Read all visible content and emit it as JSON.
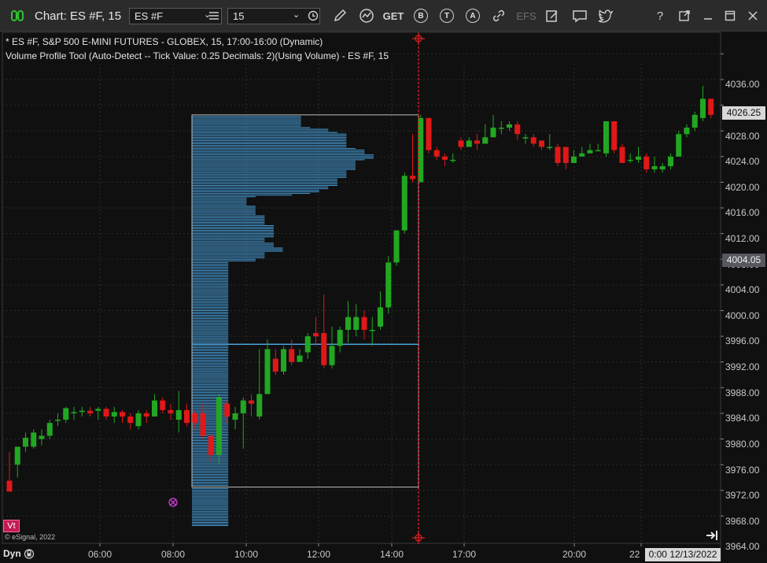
{
  "toolbar": {
    "title": "Chart: ES #F, 15",
    "symbol_value": "ES #F",
    "interval_value": "15",
    "get_label": "GET",
    "b_label": "B",
    "t_label": "T",
    "a_label": "A",
    "efs_label": "EFS",
    "help_label": "?"
  },
  "info": {
    "line1": "* ES #F, S&P 500 E-MINI FUTURES - GLOBEX, 15, 17:00-16:00 (Dynamic)",
    "line2": "Volume Profile Tool (Auto-Detect -- Tick Value: 0.25 Decimals: 2)(Using Volume) - ES #F, 15"
  },
  "footer": {
    "copyright": "© eSignal, 2022",
    "dyn_label": "Dyn",
    "vt_label": "Vt",
    "cursor_time": "0:00 12/13/2022"
  },
  "colors": {
    "up": "#22a722",
    "down": "#e01818",
    "profile": "#4aa3e0",
    "crosshair": "#e02020"
  },
  "price_tags": {
    "last": "4026.25",
    "cursor": "4004.05"
  },
  "chart_data": {
    "type": "candlestick",
    "symbol": "ES #F",
    "interval": "15",
    "y_ticks": [
      "4036.00",
      "4032.00",
      "4028.00",
      "4024.00",
      "4020.00",
      "4016.00",
      "4012.00",
      "4008.00",
      "4004.00",
      "4000.00",
      "3996.00",
      "3992.00",
      "3988.00",
      "3984.00",
      "3980.00",
      "3976.00",
      "3972.00",
      "3968.00",
      "3964.00"
    ],
    "x_ticks": [
      "06:00",
      "08:00",
      "10:00",
      "12:00",
      "14:00",
      "17:00",
      "20:00",
      "22"
    ],
    "ylim": [
      3962.2,
      4038.5
    ],
    "candles": [
      [
        3969.5,
        3967.8,
        3974.0,
        3969.5
      ],
      [
        3972.0,
        3974.8,
        3974.5,
        3970.0
      ],
      [
        3974.8,
        3976.2,
        3977.0,
        3974.0
      ],
      [
        3974.8,
        3977.0,
        3977.5,
        3974.5
      ],
      [
        3976.0,
        3976.5,
        3977.5,
        3975.0
      ],
      [
        3976.5,
        3978.5,
        3979.0,
        3976.0
      ],
      [
        3979.0,
        3979.0,
        3980.0,
        3978.0
      ],
      [
        3979.0,
        3980.8,
        3981.0,
        3978.5
      ],
      [
        3980.0,
        3980.2,
        3981.0,
        3979.0
      ],
      [
        3980.2,
        3980.4,
        3981.0,
        3979.5
      ],
      [
        3980.4,
        3980.0,
        3981.0,
        3979.5
      ],
      [
        3980.4,
        3980.7,
        3981.0,
        3979.0
      ],
      [
        3980.7,
        3979.5,
        3981.0,
        3979.0
      ],
      [
        3979.5,
        3980.2,
        3981.0,
        3978.5
      ],
      [
        3980.2,
        3979.5,
        3980.5,
        3978.5
      ],
      [
        3979.5,
        3978.5,
        3980.0,
        3977.5
      ],
      [
        3978.0,
        3980.0,
        3980.5,
        3977.5
      ],
      [
        3980.0,
        3979.5,
        3980.5,
        3978.5
      ],
      [
        3979.5,
        3982.0,
        3983.0,
        3979.5
      ],
      [
        3982.0,
        3980.5,
        3982.5,
        3980.0
      ],
      [
        3980.5,
        3980.0,
        3981.5,
        3979.0
      ],
      [
        3979.0,
        3980.5,
        3983.5,
        3977.0
      ],
      [
        3980.5,
        3978.5,
        3981.5,
        3978.0
      ],
      [
        3980.0,
        3978.5,
        3980.5,
        3977.5
      ],
      [
        3980.0,
        3976.5,
        3981.5,
        3976.0
      ],
      [
        3976.5,
        3973.5,
        3976.5,
        3972.5
      ],
      [
        3973.5,
        3982.5,
        3983.0,
        3972.0
      ],
      [
        3981.5,
        3979.5,
        3982.0,
        3978.5
      ],
      [
        3979.0,
        3980.0,
        3981.0,
        3977.5
      ],
      [
        3980.0,
        3982.0,
        3982.5,
        3974.5
      ],
      [
        3982.0,
        3981.5,
        3983.0,
        3979.5
      ],
      [
        3979.5,
        3983.0,
        3990.0,
        3979.0
      ],
      [
        3983.0,
        3990.0,
        3991.5,
        3983.0
      ],
      [
        3988.5,
        3986.5,
        3990.0,
        3986.0
      ],
      [
        3986.5,
        3990.0,
        3990.5,
        3986.0
      ],
      [
        3990.0,
        3988.0,
        3991.5,
        3987.5
      ],
      [
        3988.0,
        3989.0,
        3990.0,
        3988.0
      ],
      [
        3989.5,
        3992.0,
        3992.5,
        3988.5
      ],
      [
        3992.5,
        3992.0,
        3995.0,
        3990.5
      ],
      [
        3992.5,
        3987.5,
        3998.5,
        3987.0
      ],
      [
        3987.5,
        3990.5,
        3993.5,
        3987.0
      ],
      [
        3990.5,
        3993.0,
        3993.5,
        3989.5
      ],
      [
        3993.0,
        3995.0,
        3997.5,
        3991.0
      ],
      [
        3993.0,
        3995.0,
        3997.0,
        3992.0
      ],
      [
        3995.0,
        3993.0,
        3996.0,
        3991.5
      ],
      [
        3993.0,
        3993.0,
        3995.0,
        3990.5
      ],
      [
        3993.5,
        3996.5,
        3999.0,
        3993.0
      ],
      [
        3996.5,
        4003.5,
        4004.5,
        3995.5
      ],
      [
        4003.5,
        4008.5,
        4008.5,
        4003.0
      ],
      [
        4008.5,
        4017.0,
        4017.5,
        4008.0
      ],
      [
        4017.0,
        4016.5,
        4023.5,
        4016.0
      ],
      [
        4016.0,
        4026.0,
        4026.5,
        4016.0
      ],
      [
        4026.0,
        4021.0,
        4026.0,
        4020.5
      ],
      [
        4021.0,
        4020.0,
        4021.5,
        4019.5
      ],
      [
        4020.0,
        4019.5,
        4020.5,
        4018.5
      ],
      [
        4019.5,
        4019.5,
        4020.5,
        4019.0
      ],
      [
        4022.5,
        4021.5,
        4023.0,
        4021.0
      ],
      [
        4021.5,
        4022.5,
        4023.0,
        4021.5
      ],
      [
        4022.5,
        4022.0,
        4023.5,
        4021.0
      ],
      [
        4022.0,
        4023.0,
        4025.0,
        4022.5
      ],
      [
        4023.0,
        4024.5,
        4026.5,
        4023.0
      ],
      [
        4024.5,
        4024.5,
        4025.5,
        4023.5
      ],
      [
        4024.5,
        4025.0,
        4025.5,
        4024.0
      ],
      [
        4025.0,
        4023.5,
        4025.5,
        4022.5
      ],
      [
        4023.0,
        4023.0,
        4023.5,
        4022.0
      ],
      [
        4023.0,
        4022.0,
        4023.5,
        4021.5
      ],
      [
        4022.5,
        4021.5,
        4022.5,
        4021.0
      ],
      [
        4021.5,
        4021.5,
        4023.5,
        4021.0
      ],
      [
        4021.5,
        4019.0,
        4022.0,
        4018.5
      ],
      [
        4021.5,
        4019.0,
        4021.5,
        4018.0
      ],
      [
        4019.0,
        4020.0,
        4021.0,
        4019.0
      ],
      [
        4020.0,
        4020.5,
        4021.5,
        4020.0
      ],
      [
        4020.5,
        4021.0,
        4022.0,
        4020.5
      ],
      [
        4021.0,
        4021.0,
        4022.0,
        4021.0
      ],
      [
        4020.5,
        4025.5,
        4025.5,
        4020.0
      ],
      [
        4025.5,
        4021.0,
        4025.5,
        4020.5
      ],
      [
        4021.5,
        4019.0,
        4022.0,
        4019.0
      ],
      [
        4019.5,
        4019.5,
        4020.5,
        4019.0
      ],
      [
        4019.5,
        4020.0,
        4021.5,
        4019.0
      ],
      [
        4020.0,
        4018.0,
        4020.5,
        4017.5
      ],
      [
        4018.0,
        4018.5,
        4020.0,
        4017.5
      ],
      [
        4018.0,
        4018.5,
        4019.0,
        4017.5
      ],
      [
        4018.5,
        4020.0,
        4020.5,
        4018.0
      ],
      [
        4020.0,
        4023.5,
        4024.0,
        4020.0
      ],
      [
        4023.5,
        4024.5,
        4025.0,
        4023.0
      ],
      [
        4024.5,
        4026.5,
        4027.0,
        4024.0
      ],
      [
        4026.0,
        4029.0,
        4031.0,
        4025.5
      ],
      [
        4029.0,
        4026.5,
        4029.0,
        4026.0
      ]
    ],
    "profile_range": [
      3968.75,
      4026.25
    ],
    "profile_volumes": [
      12,
      12,
      12,
      12,
      12,
      12,
      12,
      13,
      15,
      15,
      16,
      17,
      17,
      17,
      17,
      17,
      17,
      17,
      17,
      17,
      18,
      19,
      19,
      19,
      20,
      20,
      20,
      19,
      18,
      18,
      18,
      18,
      18,
      18,
      17,
      17,
      17,
      17,
      17,
      16,
      16,
      16,
      16,
      16,
      15,
      15,
      14,
      14,
      13,
      11,
      7,
      6,
      6,
      6,
      6,
      6,
      7,
      7,
      7,
      7,
      7,
      7,
      8,
      8,
      8,
      8,
      8,
      8,
      9,
      9,
      9,
      9,
      9,
      9,
      9,
      9,
      8,
      8,
      8,
      9,
      9,
      9,
      10,
      10,
      10,
      8,
      8,
      8,
      8,
      7,
      7,
      4,
      4,
      4,
      4,
      4,
      4,
      4,
      4,
      4,
      4,
      4,
      4,
      4,
      4,
      4,
      4,
      4,
      4,
      4,
      4,
      4,
      4,
      4,
      4,
      4,
      4,
      4,
      4,
      4,
      4,
      4,
      4,
      4,
      4,
      4,
      4,
      4,
      4,
      4,
      4,
      4,
      4,
      4,
      4,
      4,
      4,
      4,
      4,
      4,
      4,
      4,
      4,
      4,
      4,
      4,
      4,
      4,
      4,
      4,
      4,
      4,
      4,
      4,
      4,
      4,
      4,
      4,
      4,
      4,
      4,
      4,
      4,
      4,
      4,
      4,
      4,
      4,
      4,
      4,
      4,
      4,
      4,
      4,
      4,
      4,
      4,
      4,
      4,
      4,
      4,
      4,
      4,
      4,
      4,
      4,
      4,
      4,
      4,
      4,
      4,
      4,
      4,
      4,
      4,
      4,
      4,
      4,
      4,
      4,
      4,
      4,
      4,
      4,
      4,
      4,
      4,
      4,
      4,
      4,
      4,
      4,
      4,
      4,
      4,
      4,
      4,
      4,
      4,
      4,
      4,
      4,
      4,
      4,
      4,
      4,
      4,
      4,
      4,
      4,
      4,
      4,
      4,
      4,
      4,
      4,
      4,
      4,
      4,
      4,
      4,
      4,
      4,
      4,
      4,
      4,
      4,
      4,
      4,
      4,
      4,
      4,
      4,
      4,
      4,
      4
    ],
    "profile_volume_max": 20,
    "grid": true
  }
}
